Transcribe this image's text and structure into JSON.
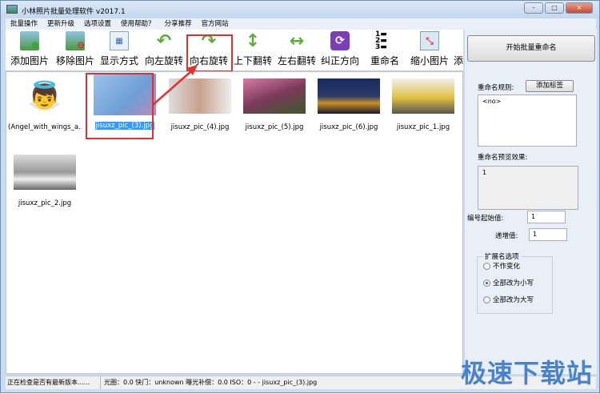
{
  "window": {
    "title": "小林照片批量处理软件 v2017.1",
    "controls": [
      "–",
      "□",
      "×"
    ]
  },
  "menu": [
    "批量操作",
    "更新升级",
    "选项设置",
    "使用帮助？",
    "分享推荐",
    "官方网站"
  ],
  "toolbar": [
    {
      "label": "添加图片",
      "icon": "add-image-icon"
    },
    {
      "label": "移除图片",
      "icon": "remove-image-icon"
    },
    {
      "label": "显示方式",
      "icon": "grid-view-icon"
    },
    {
      "label": "向左旋转",
      "icon": "rotate-left-icon"
    },
    {
      "label": "向右旋转",
      "icon": "rotate-right-icon"
    },
    {
      "label": "上下翻转",
      "icon": "flip-vertical-icon"
    },
    {
      "label": "左右翻转",
      "icon": "flip-horizontal-icon"
    },
    {
      "label": "纠正方向",
      "icon": "correct-orientation-icon"
    },
    {
      "label": "重命名",
      "icon": "rename-list-icon"
    },
    {
      "label": "缩小图片",
      "icon": "shrink-image-icon"
    },
    {
      "label": "添加",
      "icon": "add-icon"
    }
  ],
  "files": [
    {
      "name": "(Angel_with_wings_a...",
      "selected": false
    },
    {
      "name": "jisuxz_pic_(3).jpg",
      "selected": true
    },
    {
      "name": "jisuxz_pic_(4).jpg",
      "selected": false
    },
    {
      "name": "jisuxz_pic_(5).jpg",
      "selected": false
    },
    {
      "name": "jisuxz_pic_(6).jpg",
      "selected": false
    },
    {
      "name": "jisuxz_pic_1.jpg",
      "selected": false
    },
    {
      "name": "jisuxz_pic_2.jpg",
      "selected": false
    }
  ],
  "panel": {
    "start_button": "开始批量重命名",
    "rule_label": "重命名规则:",
    "add_tag_button": "添加标签",
    "rule_value": "<no>",
    "preview_label": "重命名预览效果:",
    "preview_value": "1",
    "start_num_label": "编号起始值:",
    "start_num_value": "1",
    "increment_label": "递增值:",
    "increment_value": "1",
    "ext_group_label": "扩展名选项",
    "ext_options": [
      {
        "label": "不作变化",
        "checked": false
      },
      {
        "label": "全部改为小写",
        "checked": true
      },
      {
        "label": "全部改为大写",
        "checked": false
      }
    ]
  },
  "status": {
    "left": "正在检查是否有最新版本......",
    "right": "光圈：0.0 快门：unknown 曝光补偿：0.0 ISO：0 -  - jisuxz_pic_(3).jpg"
  },
  "watermark": "极速下载站",
  "colors": {
    "highlight": "#e03030",
    "selection": "#3399ff"
  }
}
